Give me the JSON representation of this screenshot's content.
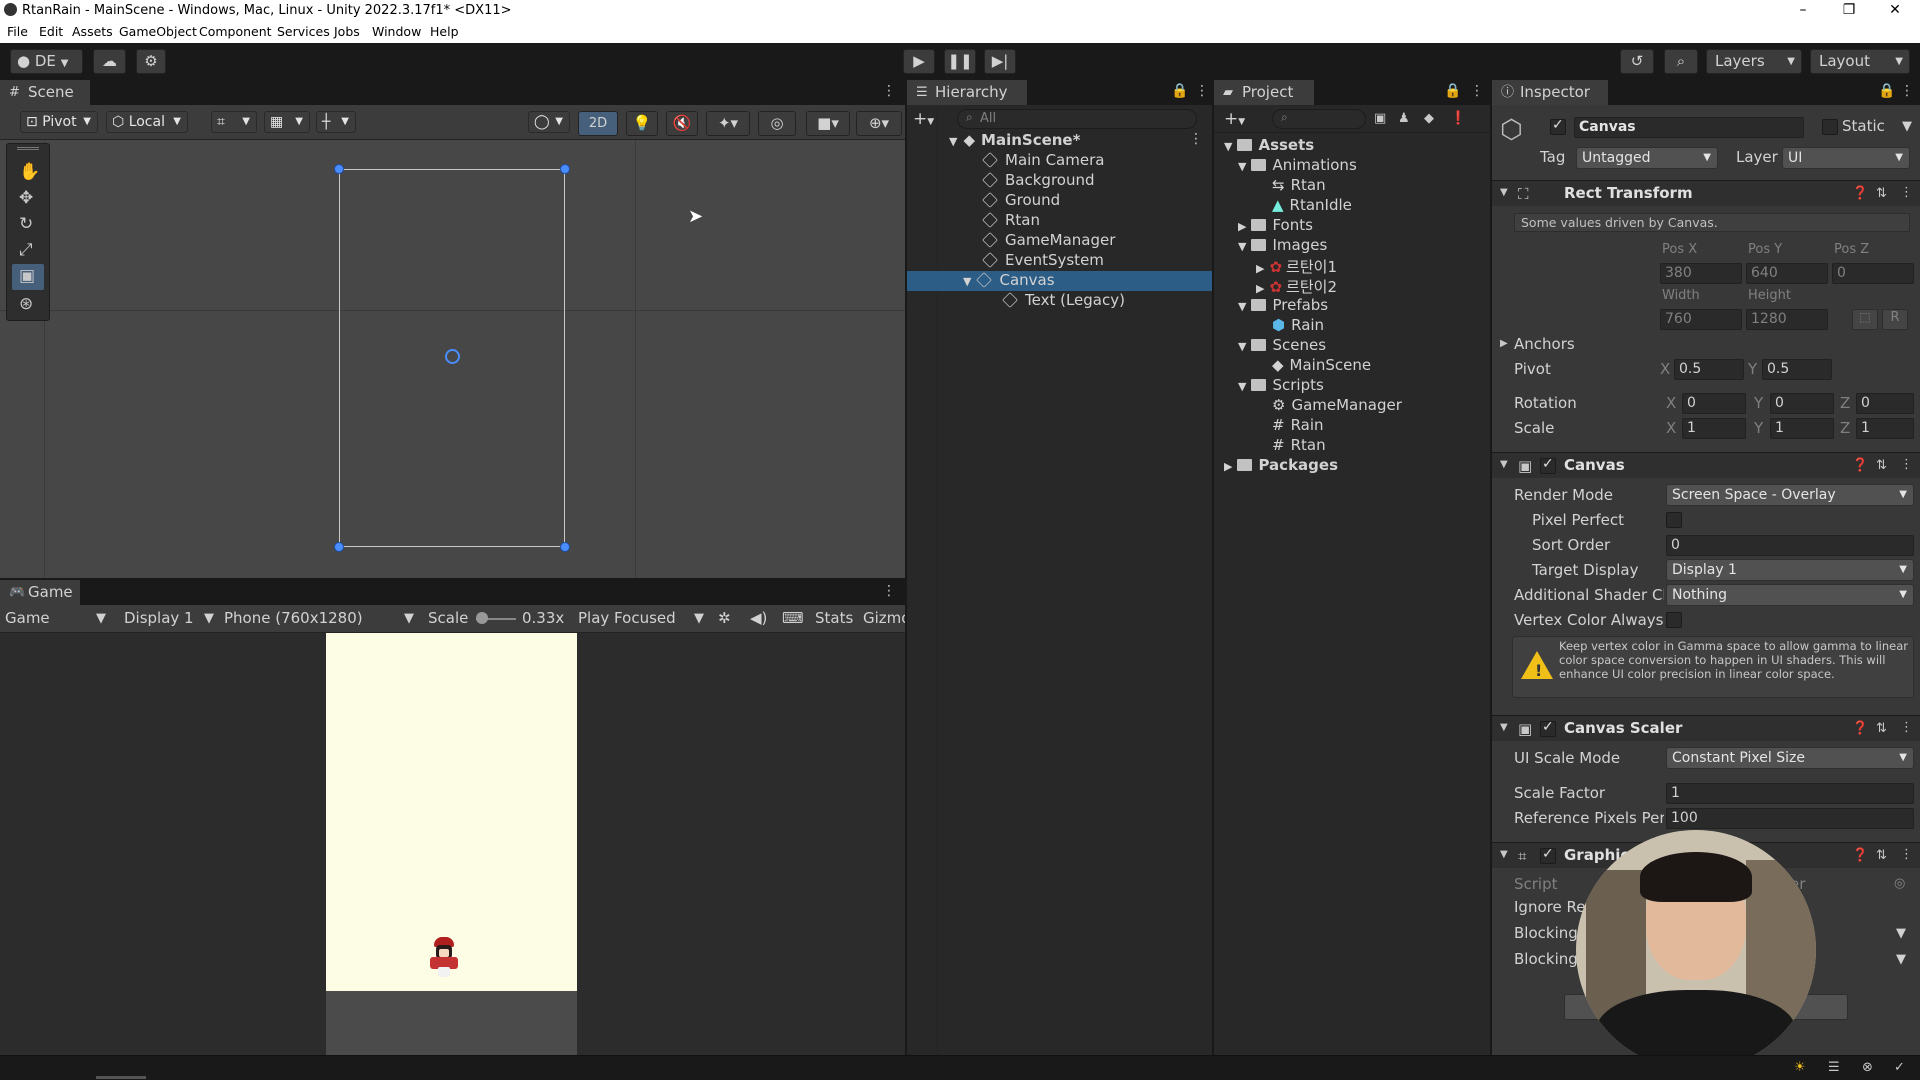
{
  "window": {
    "title": "RtanRain - MainScene - Windows, Mac, Linux - Unity 2022.3.17f1* <DX11>",
    "minimize": "–",
    "maximize": "❐",
    "close": "✕"
  },
  "menu": [
    "File",
    "Edit",
    "Assets",
    "GameObject",
    "Component",
    "Services",
    "Jobs",
    "Window",
    "Help"
  ],
  "toolbar": {
    "account": "DE",
    "layers": "Layers",
    "layout": "Layout"
  },
  "scene": {
    "tab": "Scene",
    "pivot": "Pivot",
    "local": "Local",
    "mode2d": "2D"
  },
  "game": {
    "tab": "Game",
    "view": "Game",
    "display": "Display 1",
    "resolution": "Phone (760x1280)",
    "scale_label": "Scale",
    "scale_value": "0.33x",
    "play_mode": "Play Focused",
    "stats": "Stats",
    "gizmos": "Gizmo",
    "bg_color": "#fdfde6"
  },
  "hierarchy": {
    "tab": "Hierarchy",
    "search_placeholder": "All",
    "scene": "MainScene*",
    "items": [
      "Main Camera",
      "Background",
      "Ground",
      "Rtan",
      "GameManager",
      "EventSystem",
      "Canvas"
    ],
    "child": "Text (Legacy)",
    "selected": "Canvas"
  },
  "project": {
    "tab": "Project",
    "assets": "Assets",
    "tree": {
      "animations": "Animations",
      "anim_items": [
        "Rtan",
        "RtanIdle"
      ],
      "fonts": "Fonts",
      "images": "Images",
      "image_items": [
        "르탄이1",
        "르탄이2"
      ],
      "prefabs": "Prefabs",
      "prefab_items": [
        "Rain"
      ],
      "scenes": "Scenes",
      "scene_items": [
        "MainScene"
      ],
      "scripts": "Scripts",
      "script_items": [
        "GameManager",
        "Rain",
        "Rtan"
      ],
      "packages": "Packages"
    }
  },
  "inspector": {
    "tab": "Inspector",
    "object_name": "Canvas",
    "static": "Static",
    "tag_label": "Tag",
    "tag": "Untagged",
    "layer_label": "Layer",
    "layer": "UI",
    "rect": {
      "title": "Rect Transform",
      "note": "Some values driven by Canvas.",
      "posx_label": "Pos X",
      "posy_label": "Pos Y",
      "posz_label": "Pos Z",
      "posx": "380",
      "posy": "640",
      "posz": "0",
      "width_label": "Width",
      "height_label": "Height",
      "width": "760",
      "height": "1280",
      "anchors": "Anchors",
      "pivot": "Pivot",
      "pivot_x": "0.5",
      "pivot_y": "0.5",
      "rotation": "Rotation",
      "rot_x": "0",
      "rot_y": "0",
      "rot_z": "0",
      "scale": "Scale",
      "scale_x": "1",
      "scale_y": "1",
      "scale_z": "1",
      "x": "X",
      "y": "Y",
      "z": "Z",
      "r": "R"
    },
    "canvas": {
      "title": "Canvas",
      "render_mode_label": "Render Mode",
      "render_mode": "Screen Space - Overlay",
      "pixel_perfect": "Pixel Perfect",
      "sort_order_label": "Sort Order",
      "sort_order": "0",
      "target_display_label": "Target Display",
      "target_display": "Display 1",
      "shader_label": "Additional Shader Ch",
      "shader": "Nothing",
      "vertex_label": "Vertex Color Always",
      "warning": "Keep vertex color in Gamma space to allow gamma to linear color space conversion to happen in UI shaders. This will enhance UI color precision in linear color space."
    },
    "scaler": {
      "title": "Canvas Scaler",
      "mode_label": "UI Scale Mode",
      "mode": "Constant Pixel Size",
      "factor_label": "Scale Factor",
      "factor": "1",
      "ref_label": "Reference Pixels Per",
      "ref": "100"
    },
    "raycaster": {
      "title": "Graphic R",
      "script": "Script",
      "script_value": "er",
      "ignore": "Ignore Re",
      "blocking1": "Blocking",
      "blocking2": "Blocking"
    }
  }
}
